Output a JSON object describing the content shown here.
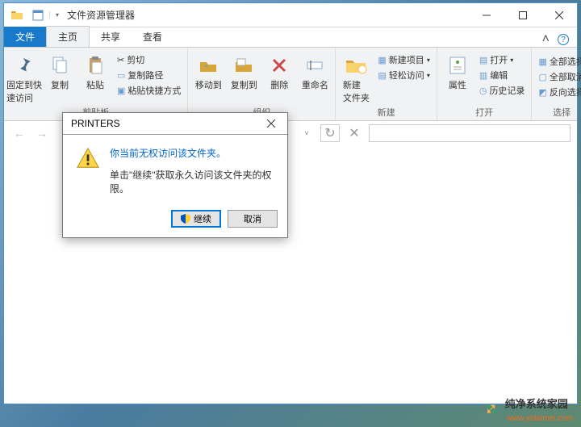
{
  "title": "文件资源管理器",
  "tabs": {
    "file": "文件",
    "home": "主页",
    "share": "共享",
    "view": "查看"
  },
  "ribbon": {
    "clipboard": {
      "pin": "固定到快\n速访问",
      "copy": "复制",
      "paste": "粘贴",
      "cut": "剪切",
      "copypath": "复制路径",
      "pasteshortcut": "粘贴快捷方式",
      "label": "剪贴板"
    },
    "organize": {
      "moveto": "移动到",
      "copyto": "复制到",
      "delete": "删除",
      "rename": "重命名",
      "label": "组织"
    },
    "new": {
      "newfolder": "新建\n文件夹",
      "newitem": "新建项目",
      "easyaccess": "轻松访问",
      "label": "新建"
    },
    "open": {
      "properties": "属性",
      "open": "打开",
      "edit": "编辑",
      "history": "历史记录",
      "label": "打开"
    },
    "select": {
      "selectall": "全部选择",
      "selectnone": "全部取消",
      "invert": "反向选择",
      "label": "选择"
    }
  },
  "dialog": {
    "title": "PRINTERS",
    "main": "你当前无权访问该文件夹。",
    "sub": "单击\"继续\"获取永久访问该文件夹的权限。",
    "continue": "继续",
    "cancel": "取消"
  },
  "watermark": {
    "text": "纯净系统家园",
    "url": "www.yidaimei.com"
  }
}
